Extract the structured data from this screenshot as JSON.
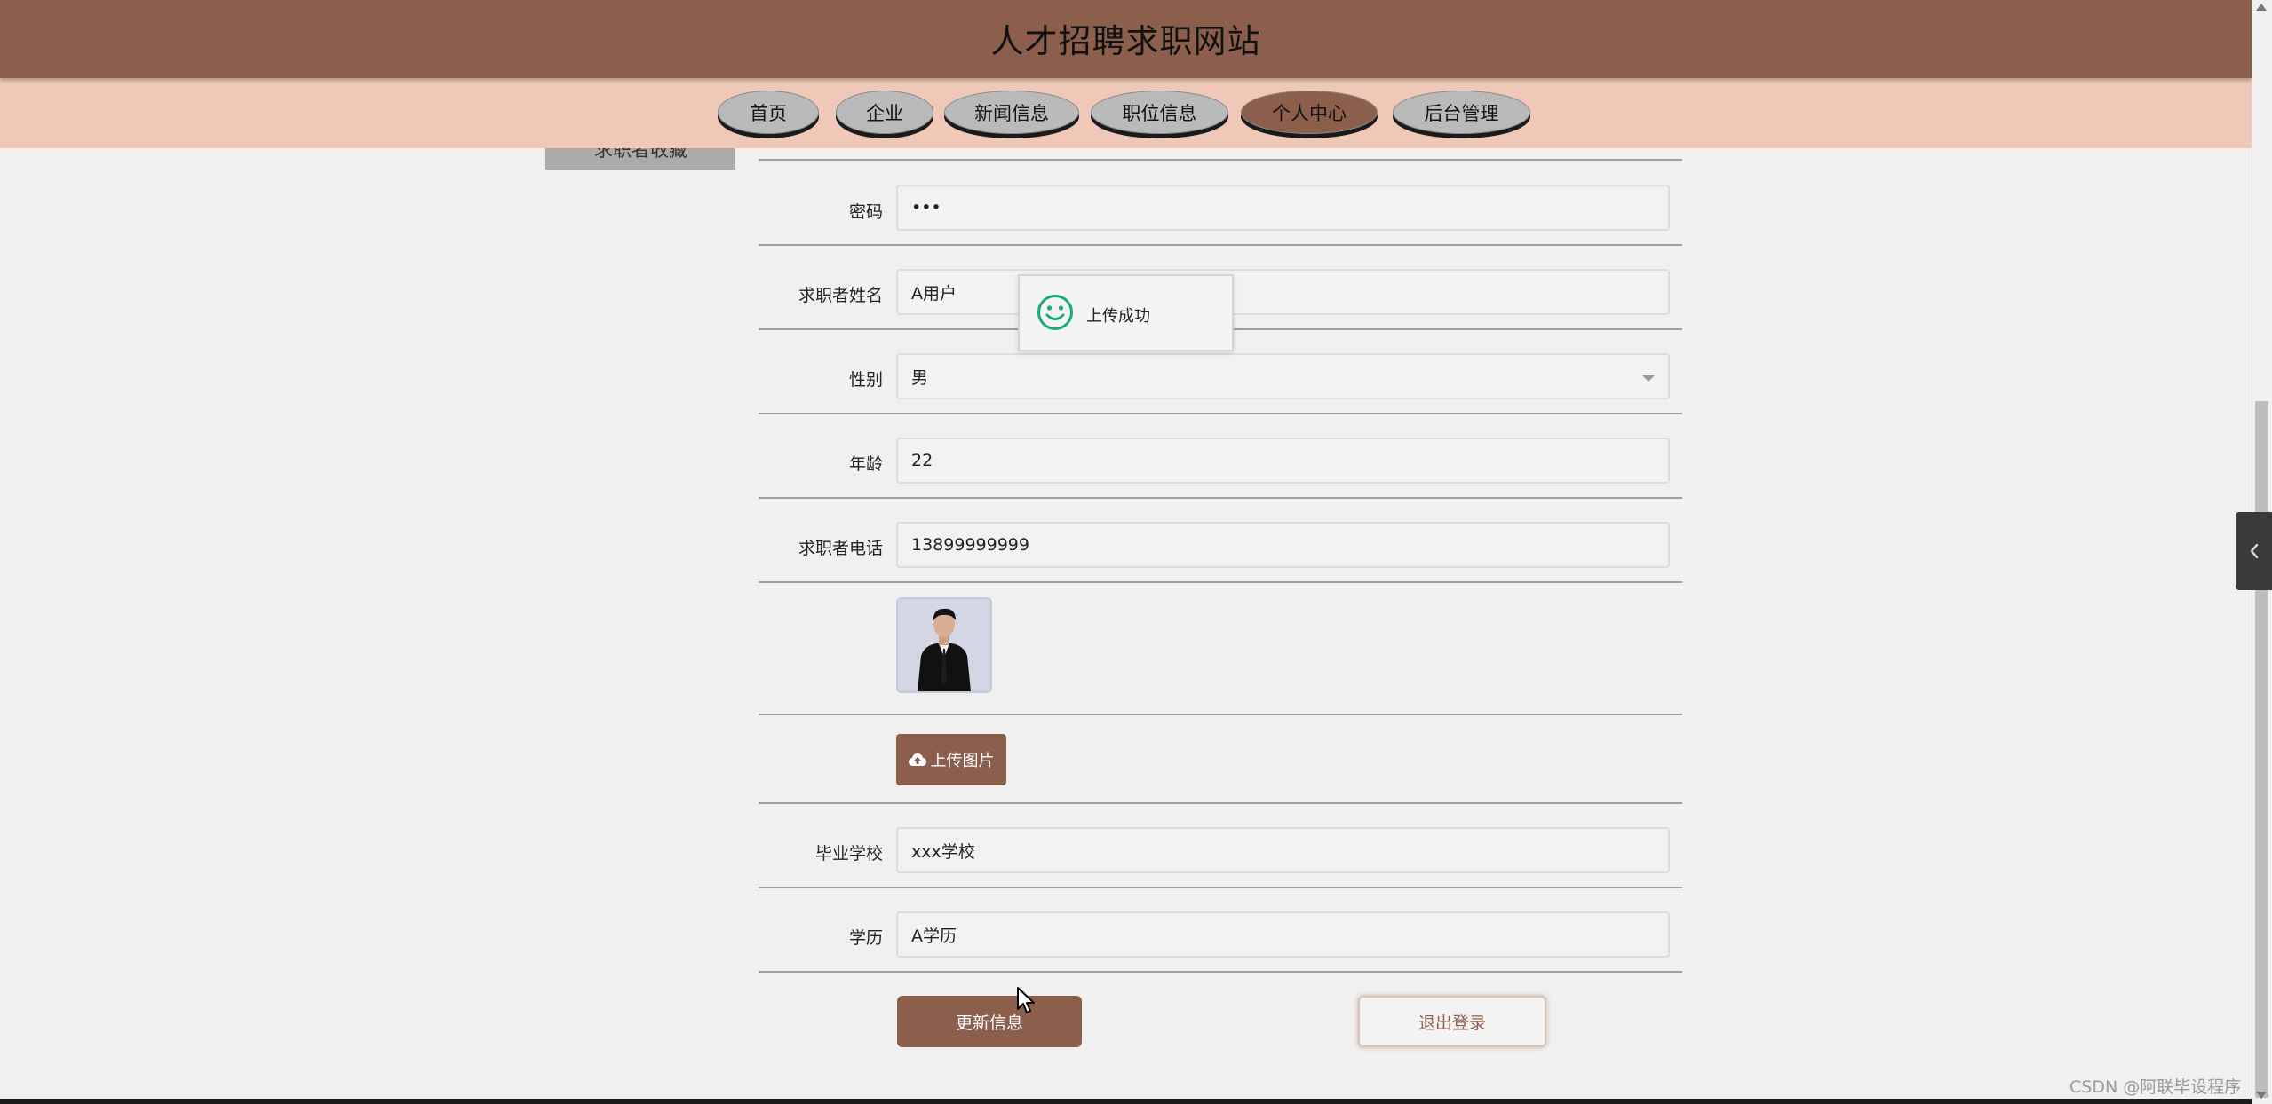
{
  "site": {
    "title": "人才招聘求职网站"
  },
  "nav": {
    "items": [
      {
        "label": "首页"
      },
      {
        "label": "企业"
      },
      {
        "label": "新闻信息"
      },
      {
        "label": "职位信息"
      },
      {
        "label": "个人中心",
        "active": true
      },
      {
        "label": "后台管理"
      }
    ]
  },
  "sidebar": {
    "partial_label": "求职者收藏"
  },
  "form": {
    "password": {
      "label": "密码",
      "value": "•••"
    },
    "name": {
      "label": "求职者姓名",
      "value": "A用户"
    },
    "gender": {
      "label": "性别",
      "value": "男"
    },
    "age": {
      "label": "年龄",
      "value": "22"
    },
    "phone": {
      "label": "求职者电话",
      "value": "13899999999"
    },
    "upload_label": "上传图片",
    "school": {
      "label": "毕业学校",
      "value": "xxx学校"
    },
    "education": {
      "label": "学历",
      "value": "A学历"
    }
  },
  "actions": {
    "update": "更新信息",
    "logout": "退出登录"
  },
  "toast": {
    "message": "上传成功"
  },
  "watermark": "CSDN @阿联毕设程序",
  "colors": {
    "brand": "#8c5f4c",
    "nav_bar": "#f0c8b8",
    "toast_icon": "#1aaa7a"
  }
}
